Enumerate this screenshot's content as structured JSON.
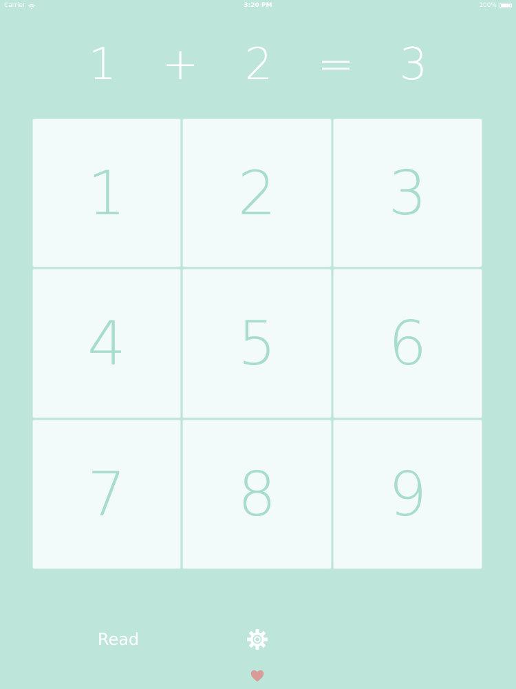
{
  "status_bar": {
    "carrier": "Carrier",
    "time": "3:20 PM",
    "battery": "100%",
    "icons": [
      "wifi-icon",
      "battery-icon"
    ]
  },
  "equation": {
    "operand_a": "1",
    "operator": "+",
    "operand_b": "2",
    "equals": "=",
    "result": "3"
  },
  "keypad": {
    "keys": [
      "1",
      "2",
      "3",
      "4",
      "5",
      "6",
      "7",
      "8",
      "9"
    ]
  },
  "toolbar": {
    "read_label": "Read",
    "settings_icon": "gear-icon",
    "heart_icon": "heart-icon"
  },
  "colors": {
    "background": "#BDE5DA",
    "key_background": "#F3FBFA",
    "key_text": "#A8DCCD",
    "header_text": "#FFFFFF",
    "heart": "#D99A98"
  }
}
